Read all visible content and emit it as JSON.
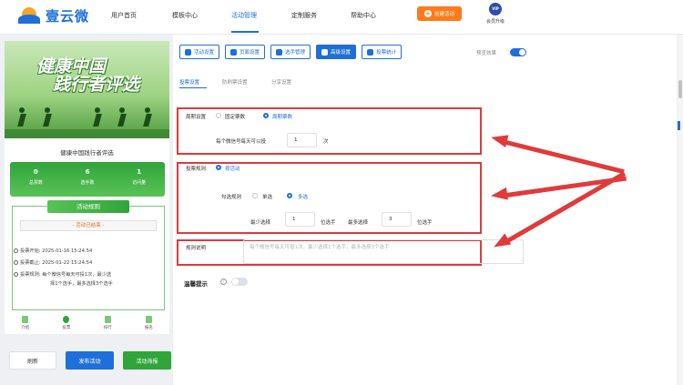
{
  "brand": {
    "name": "壹云微"
  },
  "nav": {
    "items": [
      "用户首页",
      "模板中心",
      "活动管理",
      "定制服务",
      "帮助中心"
    ],
    "active": "活动管理",
    "create_label": "创建活动",
    "vip_badge": "VIP",
    "vip_label": "会员升级"
  },
  "phone": {
    "banner_line1": "健康中国",
    "banner_line2": "践行者评选",
    "event_name": "健康中国践行者评选",
    "stats": [
      {
        "num": "0",
        "label": "总票数"
      },
      {
        "num": "6",
        "label": "选手数"
      },
      {
        "num": "1",
        "label": "访问量"
      }
    ],
    "rules_head": "活动规则",
    "ended": "- 活动已结束 -",
    "start": "投票开始:  2025-01-16 15:24:54",
    "end": "投票截止:  2025-01-22 15:24:54",
    "rule1": "投票规则:  每个微信号每天可投1次，最少选",
    "rule2": "择1个选手，最多选择3个选手",
    "tabs": [
      "介绍",
      "投票",
      "排行",
      "报名"
    ]
  },
  "actions": {
    "refresh": "刷新",
    "publish": "发布活动",
    "poster": "活动海报"
  },
  "settings_tabs": [
    "活动设置",
    "页面设置",
    "选手管理",
    "高级设置",
    "投票统计"
  ],
  "active_settings_tab": "高级设置",
  "preview_label": "预览效果",
  "subtabs": [
    "投票设置",
    "防刷票设置",
    "分享设置"
  ],
  "cycle": {
    "label": "周期设置",
    "options": [
      "固定票数",
      "周期票数"
    ],
    "selected": "周期票数",
    "per_day_label": "每个微信号每天可以投",
    "per_day_value": "1",
    "per_day_unit": "次"
  },
  "vote_rule": {
    "label": "投票规则",
    "option": "按活动",
    "select_label": "勾选规则",
    "select_options": [
      "单选",
      "多选"
    ],
    "selected": "多选",
    "min_label": "最少选择",
    "min_value": "1",
    "min_unit": "位选手",
    "max_label": "最多选择",
    "max_value": "3",
    "max_unit": "位选手"
  },
  "rule_desc": {
    "label": "规则说明",
    "placeholder": "每个微信号每天可投1次，最少选择1个选手，最多选择3个选手"
  },
  "reminder": {
    "label": "温馨提示",
    "enabled": false
  },
  "colors": {
    "brand": "#1e6fd9",
    "highlight": "#e03a3a",
    "green": "#2fa53a",
    "orange": "#ff7a1a"
  }
}
